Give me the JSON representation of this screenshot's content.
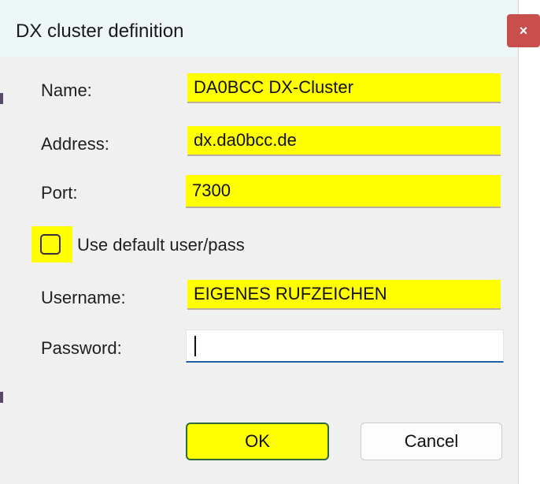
{
  "window": {
    "title": "DX cluster definition",
    "close_glyph": "×"
  },
  "form": {
    "name": {
      "label": "Name:",
      "value": "DA0BCC DX-Cluster"
    },
    "address": {
      "label": "Address:",
      "value": "dx.da0bcc.de"
    },
    "port": {
      "label": "Port:",
      "value": "7300"
    },
    "use_default": {
      "label": "Use default user/pass",
      "checked": false
    },
    "username": {
      "label": "Username:",
      "value": "EIGENES RUFZEICHEN"
    },
    "password": {
      "label": "Password:",
      "value": ""
    }
  },
  "buttons": {
    "ok": "OK",
    "cancel": "Cancel"
  },
  "colors": {
    "highlight": "#ffff00",
    "close_button": "#c94f4c",
    "focus_underline": "#1e5faa"
  }
}
